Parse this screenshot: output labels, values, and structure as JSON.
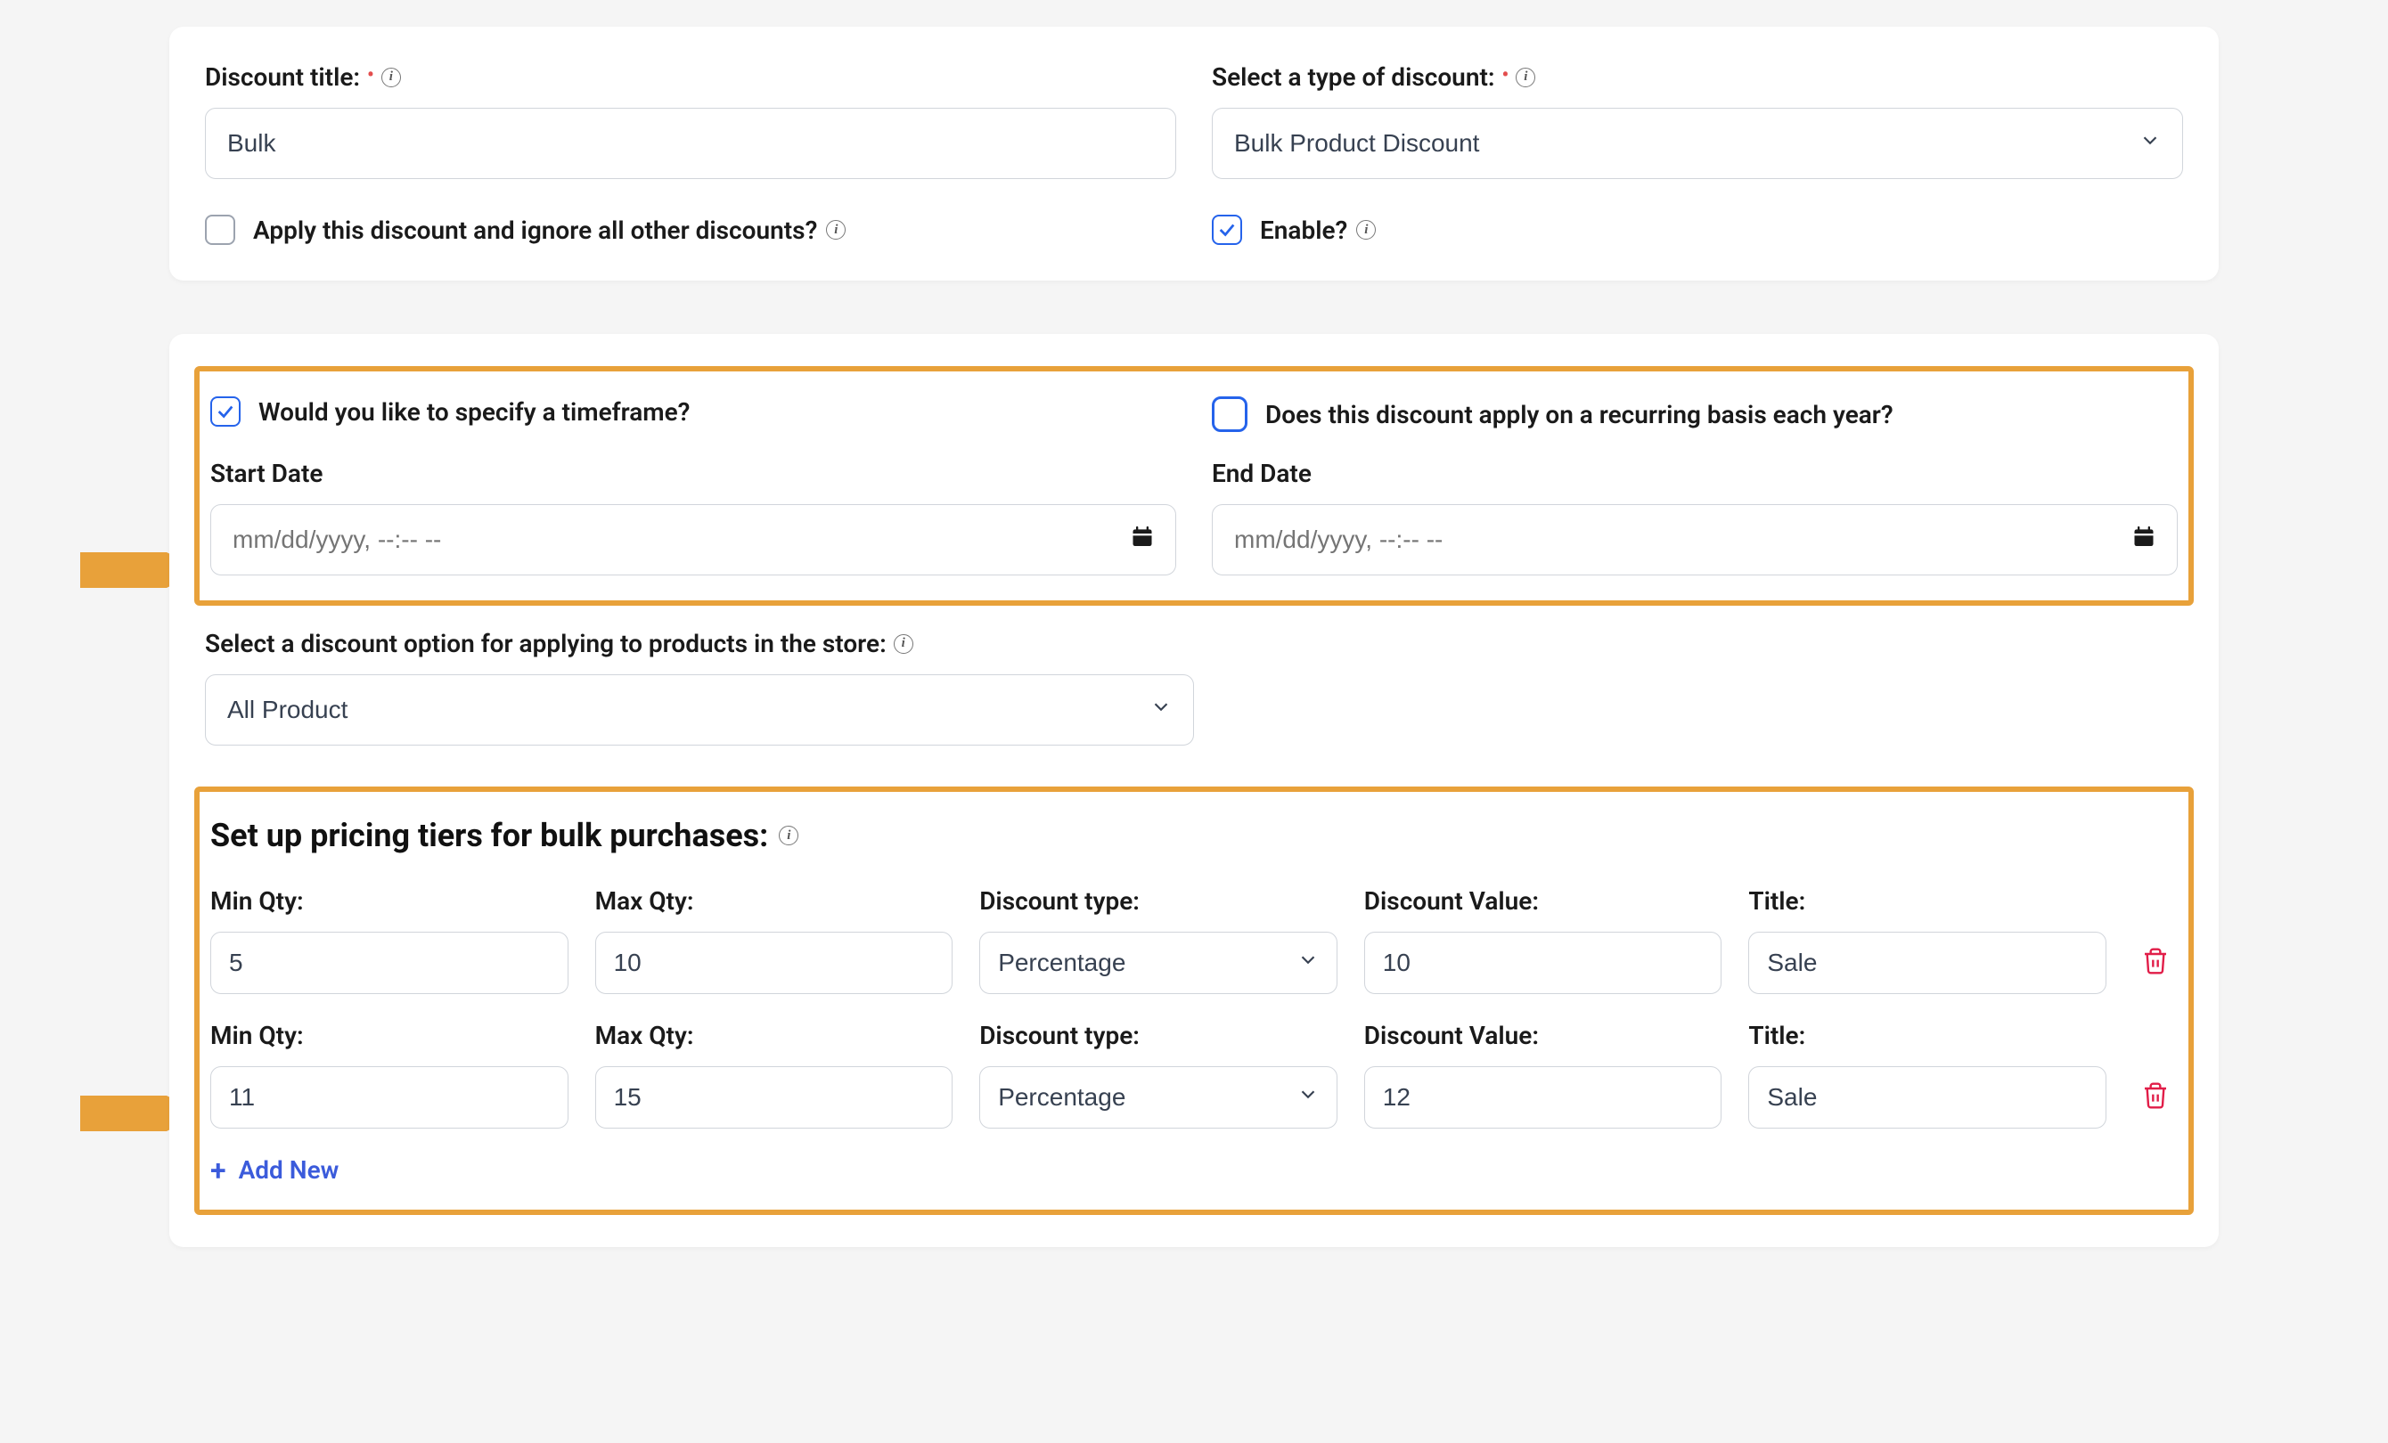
{
  "card1": {
    "discount_title_label": "Discount title:",
    "discount_title_value": "Bulk",
    "type_label": "Select a type of discount:",
    "type_value": "Bulk Product Discount",
    "ignore_others_label": "Apply this discount and ignore all other discounts?",
    "ignore_others_checked": false,
    "enable_label": "Enable?",
    "enable_checked": true
  },
  "card2": {
    "timeframe": {
      "specify_label": "Would you like to specify a timeframe?",
      "specify_checked": true,
      "recurring_label": "Does this discount apply on a recurring basis each year?",
      "recurring_checked": false,
      "start_label": "Start Date",
      "start_placeholder": "mm/dd/yyyy, --:-- --",
      "end_label": "End Date",
      "end_placeholder": "mm/dd/yyyy, --:-- --"
    },
    "option_label": "Select a discount option for applying to products in the store:",
    "option_value": "All Product",
    "tiers": {
      "heading": "Set up pricing tiers for bulk purchases:",
      "col_labels": {
        "min": "Min Qty:",
        "max": "Max Qty:",
        "type": "Discount type:",
        "value": "Discount Value:",
        "title": "Title:"
      },
      "rows": [
        {
          "min": "5",
          "max": "10",
          "type": "Percentage",
          "value": "10",
          "title": "Sale"
        },
        {
          "min": "11",
          "max": "15",
          "type": "Percentage",
          "value": "12",
          "title": "Sale"
        }
      ],
      "add_new": "Add New"
    }
  },
  "colors": {
    "highlight": "#e8a13a",
    "link": "#3b5bdb",
    "danger": "#e11d48"
  }
}
